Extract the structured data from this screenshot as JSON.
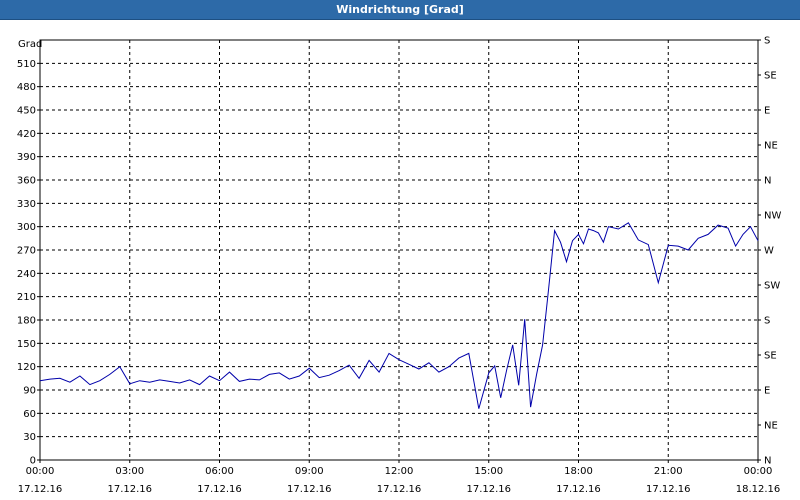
{
  "window": {
    "title": "Windrichtung [Grad]"
  },
  "chart_data": {
    "type": "line",
    "title": "Windrichtung [Grad]",
    "ylabel": "Grad",
    "ylim": [
      0,
      540
    ],
    "yticks": [
      0,
      30,
      60,
      90,
      120,
      150,
      180,
      210,
      240,
      270,
      300,
      330,
      360,
      390,
      420,
      450,
      480,
      510
    ],
    "y2ticks": [
      {
        "value": 0,
        "label": "N"
      },
      {
        "value": 45,
        "label": "NE"
      },
      {
        "value": 90,
        "label": "E"
      },
      {
        "value": 135,
        "label": "SE"
      },
      {
        "value": 180,
        "label": "S"
      },
      {
        "value": 225,
        "label": "SW"
      },
      {
        "value": 270,
        "label": "W"
      },
      {
        "value": 315,
        "label": "NW"
      },
      {
        "value": 360,
        "label": "N"
      },
      {
        "value": 405,
        "label": "NE"
      },
      {
        "value": 450,
        "label": "E"
      },
      {
        "value": 495,
        "label": "SE"
      },
      {
        "value": 540,
        "label": "S"
      }
    ],
    "xlim": [
      "17.12.16 00:00",
      "18.12.16 00:00"
    ],
    "xticks": [
      {
        "time": "00:00",
        "date": "17.12.16"
      },
      {
        "time": "03:00",
        "date": "17.12.16"
      },
      {
        "time": "06:00",
        "date": "17.12.16"
      },
      {
        "time": "09:00",
        "date": "17.12.16"
      },
      {
        "time": "12:00",
        "date": "17.12.16"
      },
      {
        "time": "15:00",
        "date": "17.12.16"
      },
      {
        "time": "18:00",
        "date": "17.12.16"
      },
      {
        "time": "21:00",
        "date": "17.12.16"
      },
      {
        "time": "00:00",
        "date": "18.12.16"
      }
    ],
    "grid": true,
    "line_color": "#0000aa",
    "series": [
      {
        "x": [
          "00:00",
          "00:20",
          "00:40",
          "01:00",
          "01:20",
          "01:40",
          "02:00",
          "02:20",
          "02:40",
          "03:00",
          "03:20",
          "03:40",
          "04:00",
          "04:20",
          "04:40",
          "05:00",
          "05:20",
          "05:40",
          "06:00",
          "06:20",
          "06:40",
          "07:00",
          "07:20",
          "07:40",
          "08:00",
          "08:20",
          "08:40",
          "09:00",
          "09:20",
          "09:40",
          "10:00",
          "10:20",
          "10:40",
          "11:00",
          "11:20",
          "11:40",
          "12:00",
          "12:20",
          "12:40",
          "13:00",
          "13:20",
          "13:40",
          "14:00",
          "14:20",
          "14:40",
          "15:00",
          "15:12",
          "15:24",
          "15:36",
          "15:48",
          "16:00",
          "16:12",
          "16:24",
          "16:36",
          "16:48",
          "17:00",
          "17:12",
          "17:24",
          "17:36",
          "17:48",
          "18:00",
          "18:10",
          "18:20",
          "18:30",
          "18:40",
          "18:50",
          "19:00",
          "19:20",
          "19:40",
          "20:00",
          "20:20",
          "20:40",
          "21:00",
          "21:20",
          "21:40",
          "22:00",
          "22:20",
          "22:40",
          "23:00",
          "23:15",
          "23:30",
          "23:45",
          "24:00"
        ],
        "values": [
          102,
          104,
          105,
          100,
          108,
          97,
          102,
          110,
          120,
          98,
          102,
          100,
          103,
          101,
          99,
          103,
          97,
          108,
          102,
          113,
          101,
          104,
          103,
          110,
          112,
          104,
          108,
          118,
          106,
          109,
          115,
          122,
          105,
          128,
          113,
          137,
          129,
          123,
          117,
          125,
          113,
          120,
          131,
          137,
          66,
          112,
          121,
          80,
          116,
          148,
          96,
          181,
          68,
          110,
          148,
          220,
          295,
          280,
          255,
          282,
          290,
          278,
          297,
          295,
          292,
          280,
          300,
          297,
          305,
          283,
          277,
          228,
          276,
          275,
          270,
          285,
          290,
          302,
          298,
          275,
          290,
          300,
          282
        ],
        "values_note": ""
      }
    ]
  }
}
